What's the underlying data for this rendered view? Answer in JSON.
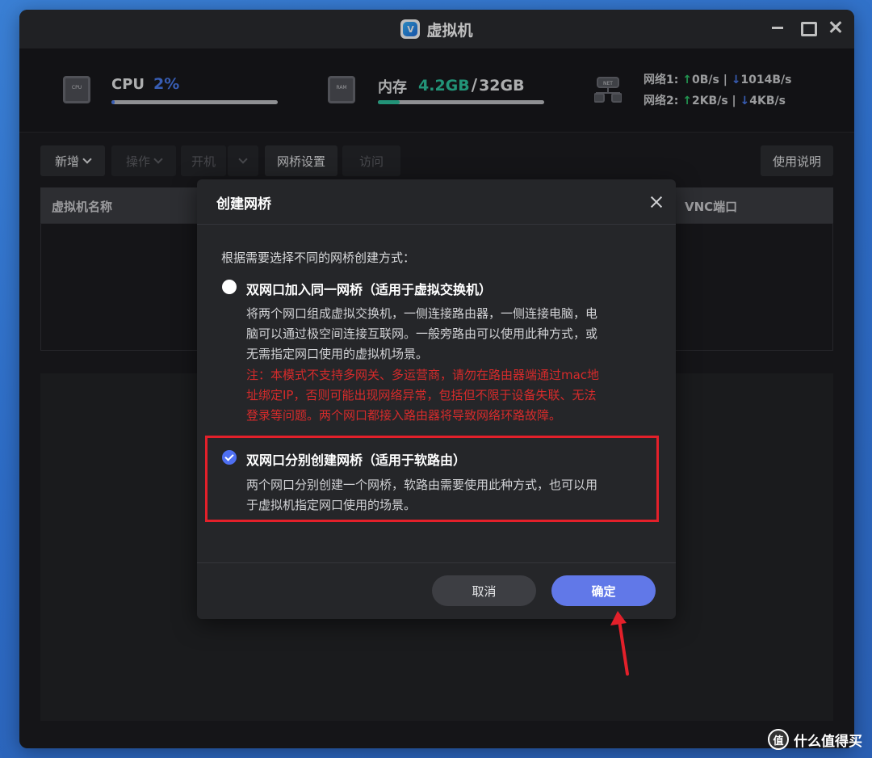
{
  "window": {
    "title": "虚拟机",
    "logo_letter": "V"
  },
  "stats": {
    "cpu": {
      "label": "CPU",
      "value": "2%",
      "usage": 0.02,
      "icon": "cpu-chip-icon",
      "icon_text": "CPU"
    },
    "ram": {
      "label": "内存",
      "value": "4.2GB",
      "separator": "/",
      "total": "32GB",
      "usage": 0.13,
      "icon": "ram-chip-icon",
      "icon_text": "RAM"
    },
    "net": {
      "icon_text": "NET",
      "net1": {
        "label": "网络1:",
        "up": "0B/s",
        "sep": "|",
        "down": "1014B/s"
      },
      "net2": {
        "label": "网络2:",
        "up": "2KB/s",
        "sep": "|",
        "down": "4KB/s"
      }
    }
  },
  "toolbar": {
    "add": "新增",
    "operate": "操作",
    "power_on": "开机",
    "bridge_settings": "网桥设置",
    "access": "访问",
    "help": "使用说明"
  },
  "table": {
    "col_name": "虚拟机名称",
    "col_vnc": "VNC端口"
  },
  "dialog": {
    "title": "创建网桥",
    "intro": "根据需要选择不同的网桥创建方式：",
    "option1": {
      "title": "双网口加入同一网桥（适用于虚拟交换机）",
      "desc_lines": [
        "将两个网口组成虚拟交换机，一侧连接路由器，一侧连接电脑，电",
        "脑可以通过极空间连接互联网。一般旁路由可以使用此种方式，或",
        "无需指定网口使用的虚拟机场景。"
      ],
      "warn_lines": [
        "注：本模式不支持多网关、多运营商，请勿在路由器端通过mac地",
        "址绑定IP，否则可能出现网络异常，包括但不限于设备失联、无法",
        "登录等问题。两个网口都接入路由器将导致网络环路故障。"
      ],
      "selected": false
    },
    "option2": {
      "title": "双网口分别创建网桥（适用于软路由）",
      "desc_lines": [
        "两个网口分别创建一个网桥，软路由需要使用此种方式，也可以用",
        "于虚拟机指定网口使用的场景。"
      ],
      "selected": true
    },
    "cancel": "取消",
    "confirm": "确定"
  },
  "colors": {
    "accent": "#4e6ff2",
    "warning": "#d62b2b",
    "highlight": "#e3202a",
    "up_arrow": "#2ec46b",
    "down_arrow": "#4b7cf0"
  },
  "watermark": {
    "logo": "值",
    "text": "什么值得买"
  }
}
